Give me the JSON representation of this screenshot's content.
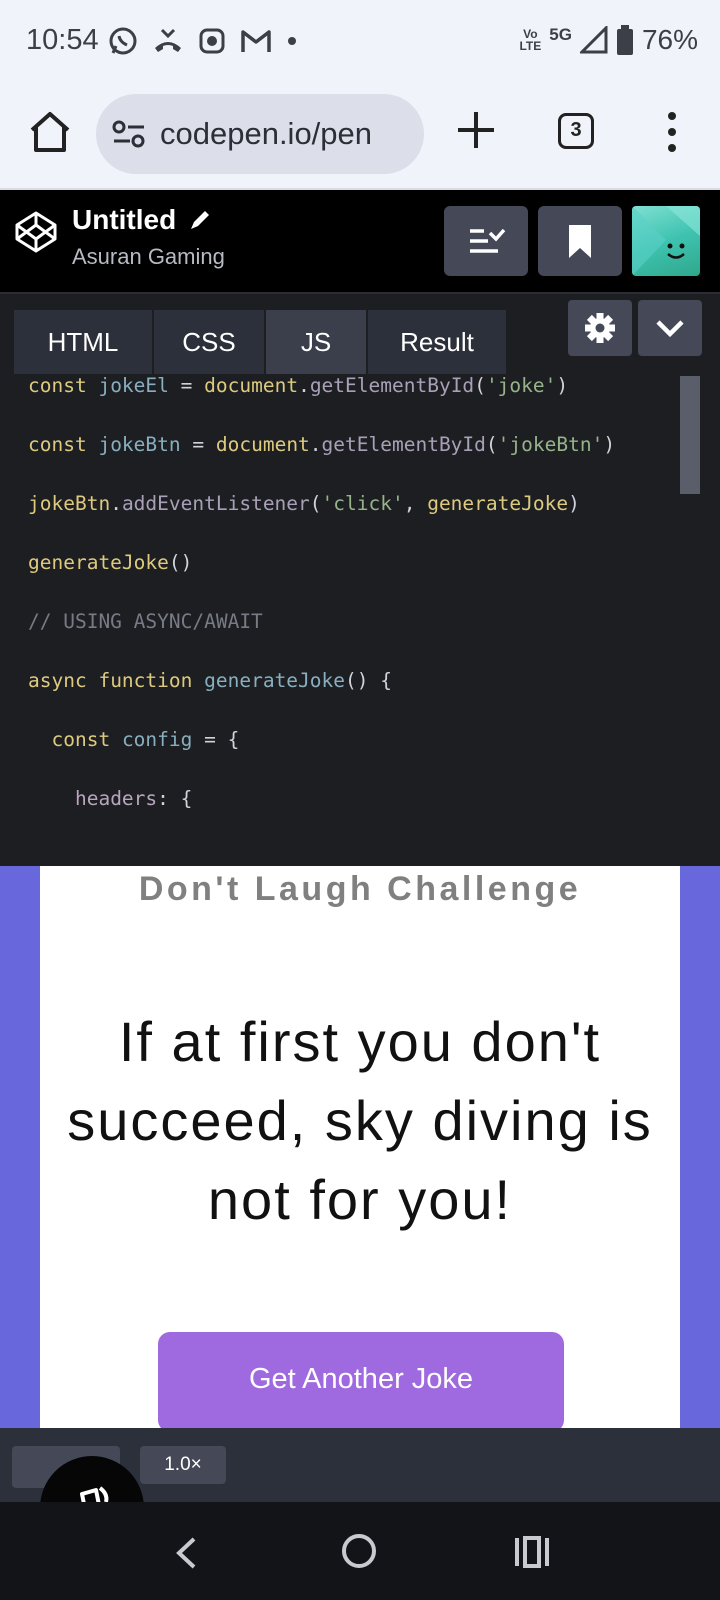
{
  "status_bar": {
    "time": "10:54",
    "network_top": "Vo",
    "network_bottom": "LTE",
    "network_type": "5G",
    "battery": "76%",
    "icons": [
      "whatsapp-icon",
      "missed-call-icon",
      "radio-icon",
      "gmail-icon",
      "dot-icon",
      "signal-icon",
      "battery-icon"
    ]
  },
  "browser": {
    "url": "codepen.io/pen",
    "tab_count": "3",
    "icons": [
      "home-icon",
      "site-settings-icon",
      "new-tab-icon",
      "tabs-icon",
      "menu-icon"
    ]
  },
  "codepen": {
    "pen_title": "Untitled",
    "user": "Asuran Gaming",
    "icons": [
      "codepen-logo-icon",
      "pencil-icon",
      "layout-icon",
      "bookmark-icon",
      "avatar-icon"
    ]
  },
  "editor": {
    "tabs": [
      {
        "label": "HTML",
        "active": false
      },
      {
        "label": "CSS",
        "active": false
      },
      {
        "label": "JS",
        "active": true
      },
      {
        "label": "Result",
        "active": false
      }
    ],
    "icons": [
      "gear-icon",
      "chevron-down-icon"
    ],
    "code_lines": [
      "const jokeEl = document.getElementById('joke')",
      "const jokeBtn = document.getElementById('jokeBtn')",
      "jokeBtn.addEventListener('click', generateJoke)",
      "generateJoke()",
      "// USING ASYNC/AWAIT",
      "async function generateJoke() {",
      "  const config = {",
      "    headers: {"
    ]
  },
  "result": {
    "title": "Don't Laugh Challenge",
    "joke": "If at first you don't succeed, sky diving is not for you!",
    "button_label": "Get Another Joke",
    "background_color": "#6867db",
    "button_color": "#9f6ae0"
  },
  "bottom_toolbar": {
    "zoom": "1.0×",
    "icons": [
      "rotate-icon"
    ]
  },
  "nav_bar": {
    "icons": [
      "back-icon",
      "home-circle-icon",
      "recent-apps-icon"
    ]
  }
}
